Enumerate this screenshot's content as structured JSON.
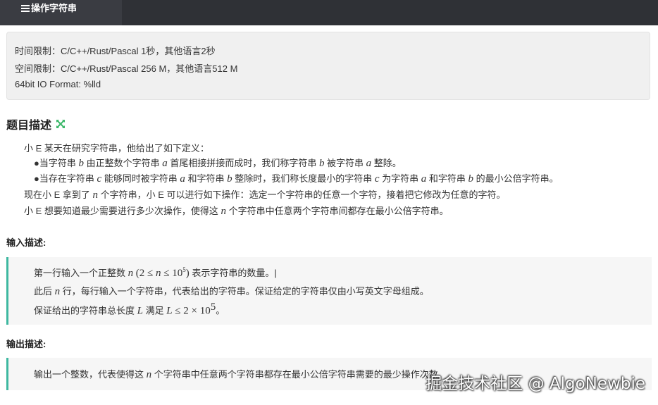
{
  "topbar": {
    "tab_label": "操作字符串",
    "tab_icon": "list-icon"
  },
  "limits": {
    "time": "时间限制：C/C++/Rust/Pascal 1秒，其他语言2秒",
    "space": "空间限制：C/C++/Rust/Pascal 256 M，其他语言512 M",
    "io": "64bit IO Format: %lld"
  },
  "description": {
    "title": "题目描述",
    "title_icon": "expand-icon",
    "lines": {
      "l1": "小 E 某天在研究字符串，他给出了如下定义：",
      "l2_a": "●当字符串 ",
      "l2_v1": "b",
      "l2_b": " 由正整数个字符串 ",
      "l2_v2": "a",
      "l2_c": " 首尾相接拼接而成时，我们称字符串 ",
      "l2_v3": "b",
      "l2_d": " 被字符串 ",
      "l2_v4": "a",
      "l2_e": " 整除。",
      "l3_a": "●当存在字符串 ",
      "l3_v1": "c",
      "l3_b": " 能够同时被字符串 ",
      "l3_v2": "a",
      "l3_c": " 和字符串 ",
      "l3_v3": "b",
      "l3_d": " 整除时，我们称长度最小的字符串 ",
      "l3_v4": "c",
      "l3_e": " 为字符串 ",
      "l3_v5": "a",
      "l3_f": " 和字符串 ",
      "l3_v6": "b",
      "l3_g": " 的最小公倍字符串。",
      "l4_a": "现在小 E 拿到了 ",
      "l4_v1": "n",
      "l4_b": " 个字符串，小 E 可以进行如下操作：选定一个字符串的任意一个字符，接着把它修改为任意的字符。",
      "l5_a": "小 E 想要知道最少需要进行多少次操作，使得这 ",
      "l5_v1": "n",
      "l5_b": " 个字符串中任意两个字符串间都存在最小公倍字符串。"
    }
  },
  "input": {
    "title": "输入描述:",
    "l1_a": "第一行输入一个正整数 ",
    "l1_v1": "n",
    "l1_m1": "(2 ≤ ",
    "l1_m2": "n",
    "l1_m3": " ≤ 10",
    "l1_exp": "5",
    "l1_m4": ")",
    "l1_b": " 表示字符串的数量。|",
    "l2_a": "此后 ",
    "l2_v1": "n",
    "l2_b": " 行，每行输入一个字符串，代表给出的字符串。保证给定的字符串仅由小写英文字母组成。",
    "l3_a": "保证给出的字符串总长度 ",
    "l3_v1": "L",
    "l3_b": " 满足 ",
    "l3_v2": "L",
    "l3_m1": " ≤ 2 × 10",
    "l3_exp": "5",
    "l3_c": "。"
  },
  "output": {
    "title": "输出描述:",
    "l1_a": "输出一个整数，代表使得这 ",
    "l1_v1": "n",
    "l1_b": " 个字符串中任意两个字符串都存在最小公倍字符串需要的最少操作次数。"
  },
  "watermark": "掘金技术社区 @ AlgoNewbie"
}
